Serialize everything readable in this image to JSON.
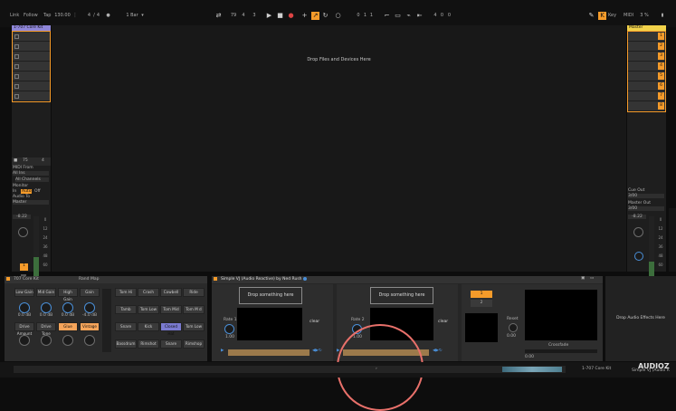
{
  "transport": {
    "link": "Link",
    "follow": "Follow",
    "tap": "Tap",
    "tempo": "130.00",
    "sig_num": "4",
    "sig_sep": "/",
    "sig_den": "4",
    "quant": "1 Bar",
    "pos_bar": "79",
    "pos_beat": "4",
    "pos_six": "3",
    "loop_bar": "0",
    "loop_beat": "1",
    "loop_six": "1",
    "len_bar": "4",
    "len_beat": "0",
    "len_six": "0",
    "key": "Key",
    "midi": "MIDI",
    "cpu": "3 %"
  },
  "left_track": {
    "name": "1-707 Core Kit",
    "vol_a": "75",
    "vol_b": "4",
    "midi_from_label": "MIDI From",
    "midi_from_value": "All Ins",
    "channel": "All Channels",
    "monitor_label": "Monitor",
    "monitor_in": "In",
    "monitor_auto": "Auto",
    "monitor_off": "Off",
    "audio_to_label": "Audio To",
    "audio_to_value": "Master",
    "volume": "-8.22",
    "track_number": "1",
    "scale": [
      "0",
      "12",
      "24",
      "36",
      "48",
      "60"
    ]
  },
  "arrangement": {
    "drop_text": "Drop Files and Devices Here"
  },
  "master": {
    "name": "Master",
    "slots": [
      "1",
      "2",
      "3",
      "4",
      "5",
      "6",
      "7",
      "8"
    ],
    "cue_out_label": "Cue Out",
    "cue_out_value": "3/00",
    "master_out_label": "Master Out",
    "master_out_value": "3/00",
    "volume": "-8.22",
    "scale": [
      "0",
      "12",
      "24",
      "36",
      "48",
      "60"
    ]
  },
  "device_kit": {
    "name": "707 Core Kit",
    "rand": "Rand",
    "map": "Map",
    "macros": [
      "Low Gain",
      "Mid Gain",
      "High Gain",
      "Gain"
    ],
    "macro_values": [
      "0.0 dB",
      "0.0 dB",
      "0.0 dB",
      "-4.0 dB"
    ],
    "macros2": [
      "Drive Amount",
      "Drive Tone",
      "Glue",
      "Vintage"
    ],
    "pads": [
      [
        "Tom Hi",
        "Crash",
        "Cowbell",
        "Ride"
      ],
      [
        "Tamb",
        "Tom Low",
        "Tom Mid",
        "Tom M d"
      ],
      [
        "Snare",
        "Kick",
        "Closed Hat",
        "Tom Low"
      ],
      [
        "Bassdrum",
        "Rimshot",
        "Snare",
        "Rimshop"
      ]
    ]
  },
  "device_vj": {
    "title": "Simple VJ (Audio Reactive) by Ned Rush",
    "drop1": "Drop something here",
    "drop2": "Drop something here",
    "rate1_label": "Rate 1",
    "rate1_value": "1.00",
    "rate2_label": "Rate 2",
    "rate2_value": "1.00",
    "clear1": "clear",
    "clear2": "clear",
    "btn1": "1",
    "btn2": "2",
    "reset_label": "Reset",
    "reset_value": "0.00",
    "crossfade_label": "Crossfade",
    "crossfade_value": "0.00"
  },
  "drop_audio": "Drop Audio Effects Here",
  "status": {
    "track": "1-707 Core Kit",
    "device": "Simple VJ (Audio R"
  },
  "watermark": "AUDIOZ",
  "colors": {
    "accent": "#f59b2a",
    "track_purple": "#8f86d8",
    "master_yellow": "#f1d24a"
  }
}
